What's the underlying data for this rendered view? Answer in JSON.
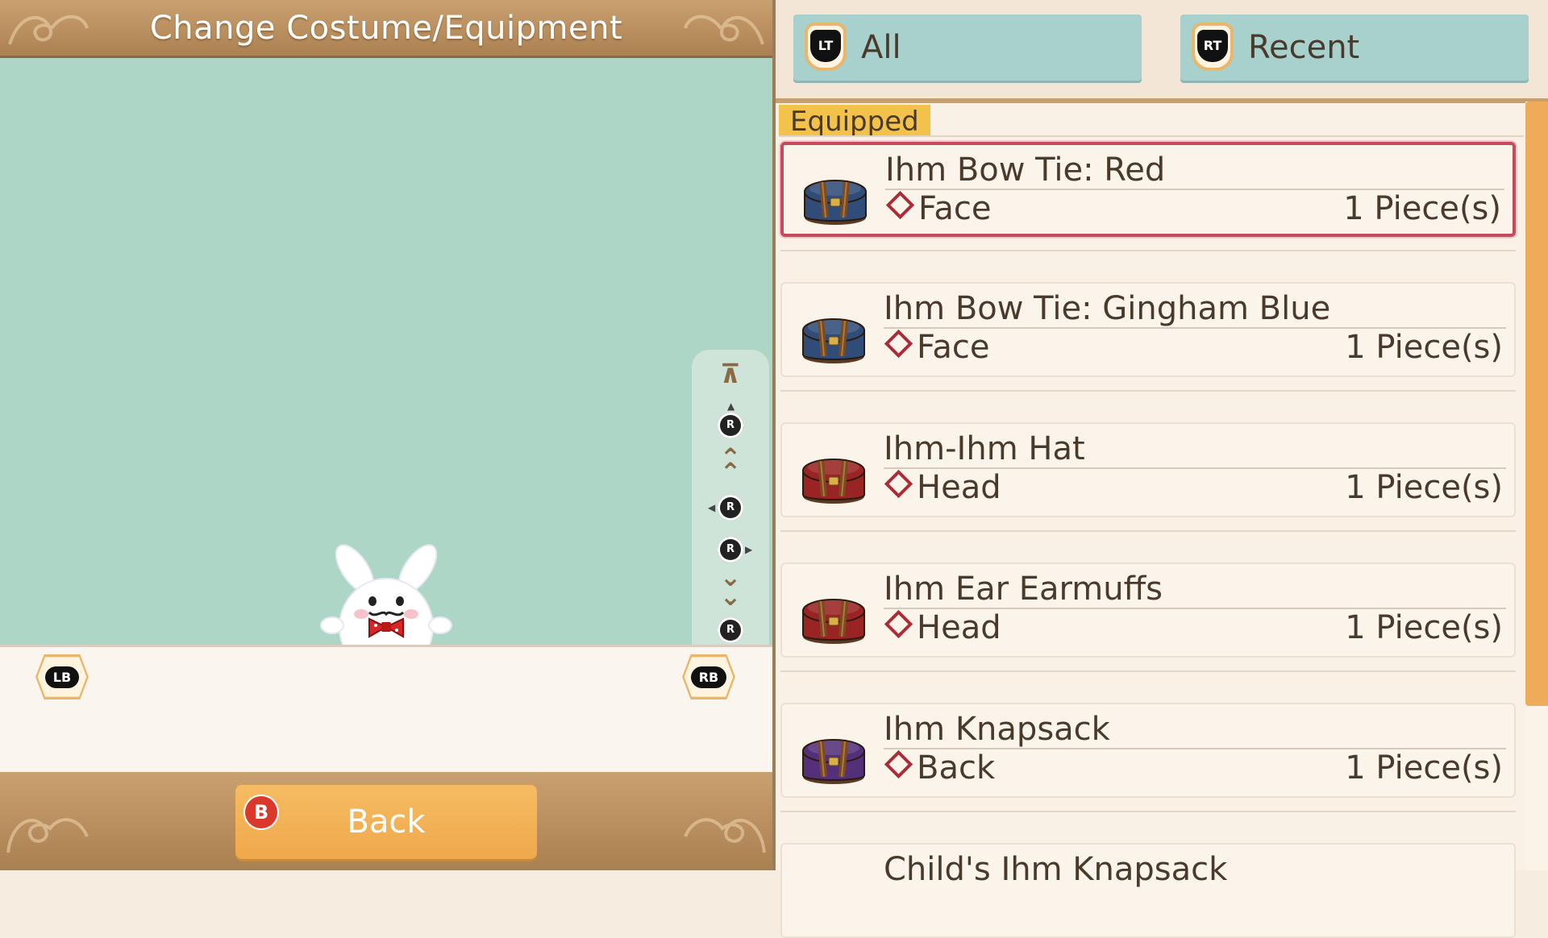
{
  "header": {
    "title": "Change Costume/Equipment"
  },
  "shoulder_buttons": {
    "left": "LB",
    "right": "RB"
  },
  "camera_controls": {
    "stick_label": "R"
  },
  "footer": {
    "back_button_icon": "B",
    "back_button_label": "Back"
  },
  "filters": {
    "tabs": [
      {
        "trigger": "LT",
        "label": "All"
      },
      {
        "trigger": "RT",
        "label": "Recent"
      }
    ]
  },
  "list": {
    "section_label": "Equipped",
    "items": [
      {
        "name": "Ihm Bow Tie: Red",
        "slot": "Face",
        "quantity": "1 Piece(s)",
        "chest_color": "#2f4d78",
        "selected": true
      },
      {
        "name": "Ihm Bow Tie: Gingham Blue",
        "slot": "Face",
        "quantity": "1 Piece(s)",
        "chest_color": "#2f4d78"
      },
      {
        "name": "Ihm-Ihm Hat",
        "slot": "Head",
        "quantity": "1 Piece(s)",
        "chest_color": "#9a2424"
      },
      {
        "name": "Ihm Ear Earmuffs",
        "slot": "Head",
        "quantity": "1 Piece(s)",
        "chest_color": "#9a2424"
      },
      {
        "name": "Ihm Knapsack",
        "slot": "Back",
        "quantity": "1 Piece(s)",
        "chest_color": "#55307a"
      },
      {
        "name": "Child's Ihm Knapsack"
      }
    ]
  },
  "colors": {
    "preview_bg": "#aed6c6",
    "banner": "#b88d5d",
    "filter_tab": "#a8d0cc",
    "equipped_tag": "#f3c24b",
    "selected_border": "#c44a5c",
    "scroll_thumb": "#eeac5a",
    "back_button": "#f0a84c"
  }
}
